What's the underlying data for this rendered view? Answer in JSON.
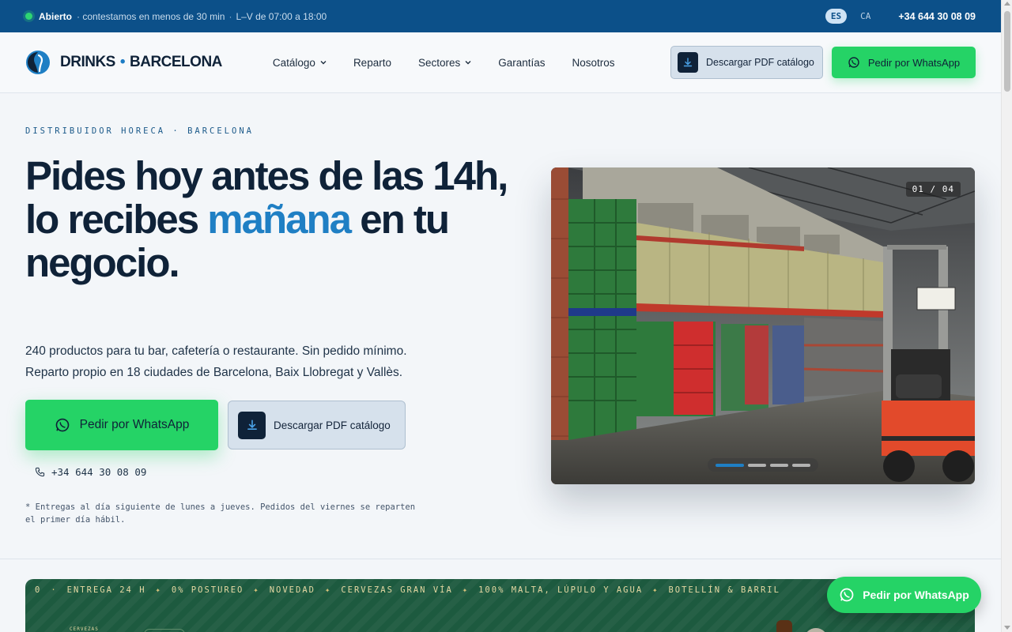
{
  "topbar": {
    "status": "Abierto",
    "response": "· contestamos en menos de 30 min",
    "sep": "·",
    "hours": "L–V de 07:00 a 18:00",
    "langs": [
      "ES",
      "CA"
    ],
    "phone": "+34 644 30 08 09"
  },
  "header": {
    "logo_left": "DRINKS",
    "logo_bullet": "•",
    "logo_right": "BARCELONA",
    "nav": [
      "Catálogo",
      "Reparto",
      "Sectores",
      "Garantías",
      "Nosotros"
    ],
    "pdf_button": "Descargar PDF catálogo",
    "whatsapp_button": "Pedir por WhatsApp"
  },
  "hero": {
    "eyebrow": "DISTRIBUIDOR HORECA · BARCELONA",
    "title_line1": "Pides hoy antes de las 14h,",
    "title_line2_a": "lo recibes ",
    "title_accent": "mañana",
    "title_line2_b": " en tu negocio.",
    "subtitle_line1": "240 productos para tu bar, cafetería o restaurante. Sin pedido mínimo.",
    "subtitle_line2": "Reparto propio en 18 ciudades de Barcelona, Baix Llobregat y Vallès.",
    "whatsapp_button": "Pedir por WhatsApp",
    "pdf_button": "Descargar PDF catálogo",
    "phone": "+34 644 30 08 09",
    "note": "* Entregas al día siguiente de lunes a jueves. Pedidos del viernes se reparten el primer día hábil."
  },
  "slideshow": {
    "counter": "01 / 04",
    "slides_total": 4,
    "active_index": 1
  },
  "banner": {
    "ticker": [
      "0",
      "ENTREGA 24 H",
      "0% POSTUREO",
      "NOVEDAD",
      "CERVEZAS GRAN VÍA",
      "100% MALTA, LÚPULO Y AGUA",
      "BOTELLÍN & BARRIL"
    ],
    "tiny_label": "CERVEZAS"
  },
  "floating": {
    "whatsapp_button": "Pedir por WhatsApp"
  },
  "colors": {
    "topbar": "#0c5089",
    "accent": "#1f7fc4",
    "whatsapp": "#25d366",
    "banner": "#1d5a3f",
    "ink": "#0f2238"
  }
}
